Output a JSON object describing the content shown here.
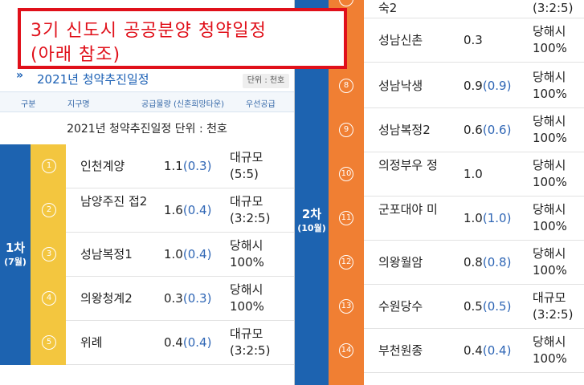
{
  "banner": {
    "line1": "3기 신도시 공공분양 청약일정",
    "line2": "(아래 참조)"
  },
  "header": {
    "title": "2021년 청약추진일정",
    "unit": "단위 : 천호",
    "columns": [
      "구분",
      "지구명",
      "공급물량 (신혼희망타운)",
      "우선공급"
    ]
  },
  "caption": "2021년 청약추진일정 단위 : 천호",
  "phase1": {
    "label": "1차",
    "month": "(7월)",
    "rows": [
      {
        "num": "1",
        "name": "인천계양",
        "value": "1.1",
        "paren": "(0.3)",
        "priority": "대규모 (5:5)"
      },
      {
        "num": "2",
        "name": "남양주진 접2",
        "value": "1.6",
        "paren": "(0.4)",
        "priority": "대규모 (3:2:5)"
      },
      {
        "num": "3",
        "name": "성남복정1",
        "value": "1.0",
        "paren": "(0.4)",
        "priority": "당해시 100%"
      },
      {
        "num": "4",
        "name": "의왕청계2",
        "value": "0.3",
        "paren": "(0.3)",
        "priority": "당해시 100%"
      },
      {
        "num": "5",
        "name": "위례",
        "value": "0.4",
        "paren": "(0.4)",
        "priority": "대규모 (3:2:5)"
      }
    ]
  },
  "phase2": {
    "label": "2차",
    "month": "(10월)",
    "rows": [
      {
        "num": "",
        "name": "숙2",
        "value": "",
        "paren": "",
        "priority": "(3:2:5)"
      },
      {
        "num": "",
        "name": "성남신촌",
        "value": "0.3",
        "paren": "",
        "priority": "당해시 100%"
      },
      {
        "num": "8",
        "name": "성남낙생",
        "value": "0.9",
        "paren": "(0.9)",
        "priority": "당해시 100%"
      },
      {
        "num": "9",
        "name": "성남복정2",
        "value": "0.6",
        "paren": "(0.6)",
        "priority": "당해시 100%"
      },
      {
        "num": "10",
        "name": "의정부우 정",
        "value": "1.0",
        "paren": "",
        "priority": "당해시 100%"
      },
      {
        "num": "11",
        "name": "군포대야 미",
        "value": "1.0",
        "paren": "(1.0)",
        "priority": "당해시 100%"
      },
      {
        "num": "12",
        "name": "의왕월암",
        "value": "0.8",
        "paren": "(0.8)",
        "priority": "당해시 100%"
      },
      {
        "num": "13",
        "name": "수원당수",
        "value": "0.5",
        "paren": "(0.5)",
        "priority": "대규모 (3:2:5)"
      },
      {
        "num": "14",
        "name": "부천원종",
        "value": "0.4",
        "paren": "(0.4)",
        "priority": "당해시 100%"
      }
    ]
  },
  "colors": {
    "phase_blue": "#1d63b0",
    "phase1_yellow": "#f3c63f",
    "phase2_orange": "#f07f33",
    "banner_red": "#e0101a",
    "paren_blue": "#2f66b5"
  }
}
